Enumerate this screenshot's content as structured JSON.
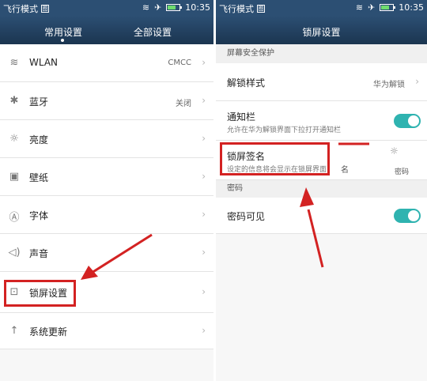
{
  "left": {
    "status": {
      "mode": "飞行模式",
      "sim": "图",
      "time": "10:35"
    },
    "tabs": [
      "常用设置",
      "全部设置"
    ],
    "items": [
      {
        "icon": "wifi-icon",
        "glyph": "≋",
        "label": "WLAN",
        "value": "CMCC"
      },
      {
        "icon": "bluetooth-icon",
        "glyph": "✱",
        "label": "蓝牙",
        "value": "关闭"
      },
      {
        "icon": "brightness-icon",
        "glyph": "☼",
        "label": "亮度",
        "value": ""
      },
      {
        "icon": "wallpaper-icon",
        "glyph": "▣",
        "label": "壁纸",
        "value": ""
      },
      {
        "icon": "font-icon",
        "glyph": "Ⓐ",
        "label": "字体",
        "value": ""
      },
      {
        "icon": "sound-icon",
        "glyph": "◁)",
        "label": "声音",
        "value": ""
      },
      {
        "icon": "lock-icon",
        "glyph": "⊡",
        "label": "锁屏设置",
        "value": ""
      },
      {
        "icon": "update-icon",
        "glyph": "↑",
        "label": "系统更新",
        "value": ""
      }
    ]
  },
  "right": {
    "status": {
      "mode": "飞行模式",
      "sim": "图",
      "time": "10:35"
    },
    "title": "锁屏设置",
    "sections": {
      "security": "屏幕安全保护",
      "password": "密码"
    },
    "unlock_style": {
      "label": "解锁样式",
      "value": "华为解锁"
    },
    "notification": {
      "label": "通知栏",
      "desc": "允许在华为解锁界面下拉打开通知栏"
    },
    "signature": {
      "label": "锁屏签名",
      "desc": "设定的信息将会显示在锁屏界面"
    },
    "password_visible": {
      "label": "密码可见"
    },
    "stray": {
      "char": "名",
      "password": "密码",
      "gear": "☼"
    }
  },
  "colors": {
    "accent": "#2fb3b0",
    "highlight": "#d32222",
    "appbar": "#2c4f73"
  }
}
